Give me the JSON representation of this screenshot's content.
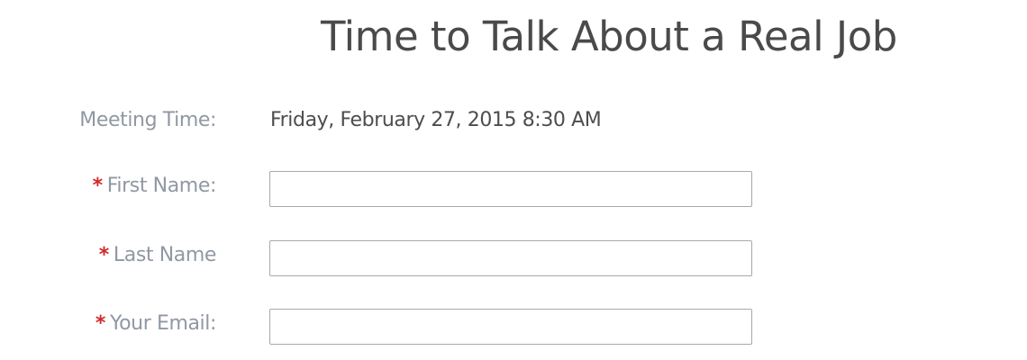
{
  "page": {
    "title": "Time to Talk About a Real Job"
  },
  "form": {
    "meeting_time_label": "Meeting Time:",
    "meeting_time_value": "Friday, February 27, 2015 8:30 AM",
    "required_marker": "*",
    "first_name": {
      "label": "First Name:",
      "value": "",
      "placeholder": ""
    },
    "last_name": {
      "label": "Last Name",
      "value": "",
      "placeholder": ""
    },
    "email": {
      "label": "Your Email:",
      "value": "",
      "placeholder": ""
    }
  },
  "colors": {
    "title": "#4a4a4a",
    "label": "#9098a3",
    "required": "#d22a2a",
    "field_border": "#a9a9a9"
  }
}
